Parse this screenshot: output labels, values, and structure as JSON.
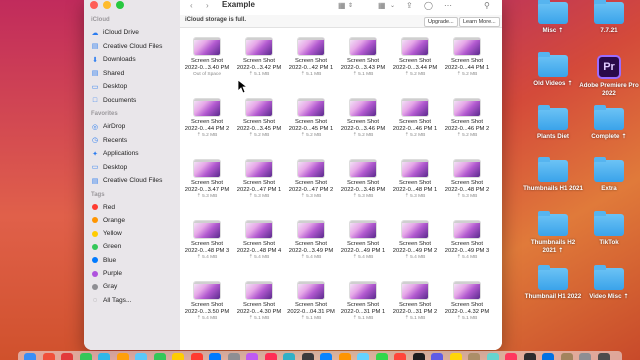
{
  "window": {
    "title": "Example"
  },
  "sidebar": {
    "icloud_header": "iCloud",
    "icloud_items": [
      {
        "label": "iCloud Drive",
        "icon": "cloud-icon"
      },
      {
        "label": "Creative Cloud Files",
        "icon": "folder-icon"
      },
      {
        "label": "Downloads",
        "icon": "download-icon"
      },
      {
        "label": "Shared",
        "icon": "shared-folder-icon"
      },
      {
        "label": "Desktop",
        "icon": "desktop-icon"
      },
      {
        "label": "Documents",
        "icon": "document-icon"
      }
    ],
    "favorites_header": "Favorites",
    "favorite_items": [
      {
        "label": "AirDrop",
        "icon": "airdrop-icon"
      },
      {
        "label": "Recents",
        "icon": "clock-icon"
      },
      {
        "label": "Applications",
        "icon": "applications-icon"
      },
      {
        "label": "Desktop",
        "icon": "desktop-icon"
      },
      {
        "label": "Creative Cloud Files",
        "icon": "folder-icon"
      }
    ],
    "tags_header": "Tags",
    "tags": [
      {
        "label": "Red",
        "color": "#ff3b30"
      },
      {
        "label": "Orange",
        "color": "#ff9500"
      },
      {
        "label": "Yellow",
        "color": "#ffcc00"
      },
      {
        "label": "Green",
        "color": "#34c759"
      },
      {
        "label": "Blue",
        "color": "#007aff"
      },
      {
        "label": "Purple",
        "color": "#af52de"
      },
      {
        "label": "Gray",
        "color": "#8e8e93"
      },
      {
        "label": "All Tags...",
        "color": ""
      }
    ]
  },
  "notice": {
    "text": "iCloud storage is full.",
    "upgrade": "Upgrade...",
    "learn_more": "Learn More..."
  },
  "files": [
    [
      {
        "name": "Screen Shot",
        "date": "2022-0...3.40 PM",
        "meta": "Out of Space"
      },
      {
        "name": "Screen Shot",
        "date": "2022-0...3.42 PM",
        "meta": "⇡ 5.1 MB"
      },
      {
        "name": "Screen Shot",
        "date": "2022-0...42 PM 1",
        "meta": "⇡ 5.1 MB"
      },
      {
        "name": "Screen Shot",
        "date": "2022-0...3.43 PM",
        "meta": "⇡ 5.1 MB"
      },
      {
        "name": "Screen Shot",
        "date": "2022-0...3.44 PM",
        "meta": "⇡ 5.2 MB"
      },
      {
        "name": "Screen Shot",
        "date": "2022-0...44 PM 1",
        "meta": "⇡ 5.2 MB"
      }
    ],
    [
      {
        "name": "Screen Shot",
        "date": "2022-0...44 PM 2",
        "meta": "⇡ 5.2 MB"
      },
      {
        "name": "Screen Shot",
        "date": "2022-0...3.45 PM",
        "meta": "⇡ 5.2 MB"
      },
      {
        "name": "Screen Shot",
        "date": "2022-0...45 PM 1",
        "meta": "⇡ 5.2 MB"
      },
      {
        "name": "Screen Shot",
        "date": "2022-0...3.46 PM",
        "meta": "⇡ 5.2 MB"
      },
      {
        "name": "Screen Shot",
        "date": "2022-0...46 PM 1",
        "meta": "⇡ 5.2 MB"
      },
      {
        "name": "Screen Shot",
        "date": "2022-0...46 PM 2",
        "meta": "⇡ 5.2 MB"
      }
    ],
    [
      {
        "name": "Screen Shot",
        "date": "2022-0...3.47 PM",
        "meta": "⇡ 5.3 MB"
      },
      {
        "name": "Screen Shot",
        "date": "2022-0...47 PM 1",
        "meta": "⇡ 5.3 MB"
      },
      {
        "name": "Screen Shot",
        "date": "2022-0...47 PM 2",
        "meta": "⇡ 5.3 MB"
      },
      {
        "name": "Screen Shot",
        "date": "2022-0...3.48 PM",
        "meta": "⇡ 5.3 MB"
      },
      {
        "name": "Screen Shot",
        "date": "2022-0...48 PM 1",
        "meta": "⇡ 5.3 MB"
      },
      {
        "name": "Screen Shot",
        "date": "2022-0...48 PM 2",
        "meta": "⇡ 5.3 MB"
      }
    ],
    [
      {
        "name": "Screen Shot",
        "date": "2022-0...48 PM 3",
        "meta": "⇡ 5.4 MB"
      },
      {
        "name": "Screen Shot",
        "date": "2022-0...48 PM 4",
        "meta": "⇡ 5.4 MB"
      },
      {
        "name": "Screen Shot",
        "date": "2022-0...3.49 PM",
        "meta": "⇡ 5.4 MB"
      },
      {
        "name": "Screen Shot",
        "date": "2022-0...49 PM 1",
        "meta": "⇡ 5.4 MB"
      },
      {
        "name": "Screen Shot",
        "date": "2022-0...49 PM 2",
        "meta": "⇡ 5.4 MB"
      },
      {
        "name": "Screen Shot",
        "date": "2022-0...49 PM 3",
        "meta": "⇡ 5.4 MB"
      }
    ],
    [
      {
        "name": "Screen Shot",
        "date": "2022-0...3.50 PM",
        "meta": "⇡ 5.4 MB"
      },
      {
        "name": "Screen Shot",
        "date": "2022-0...4.30 PM",
        "meta": "⇡ 5.1 MB"
      },
      {
        "name": "Screen Shot",
        "date": "2022-0...04.31 PM",
        "meta": "⇡ 5.1 MB"
      },
      {
        "name": "Screen Shot",
        "date": "2022-0...31 PM 1",
        "meta": "⇡ 5.1 MB"
      },
      {
        "name": "Screen Shot",
        "date": "2022-0...31 PM 2",
        "meta": "⇡ 5.1 MB"
      },
      {
        "name": "Screen Shot",
        "date": "2022-0...4.32 PM",
        "meta": "⇡ 5.1 MB"
      }
    ]
  ],
  "desktop": [
    {
      "label": "Misc",
      "status": "⇡",
      "type": "folder"
    },
    {
      "label": "7.7.21",
      "status": "",
      "type": "folder"
    },
    {
      "label": "Old Videos",
      "status": "⇡",
      "type": "folder"
    },
    {
      "label": "Adobe Premiere Pro 2022",
      "status": "",
      "type": "app",
      "app_letters": "Pr"
    },
    {
      "label": "Plants Diet",
      "status": "",
      "type": "folder"
    },
    {
      "label": "Complete",
      "status": "⇡",
      "type": "folder"
    },
    {
      "label": "Thumbnails H1 2021",
      "status": "",
      "type": "folder"
    },
    {
      "label": "Extra",
      "status": "",
      "type": "folder"
    },
    {
      "label": "Thumbnails H2 2021",
      "status": "⇡",
      "type": "folder"
    },
    {
      "label": "TikTok",
      "status": "",
      "type": "folder"
    },
    {
      "label": "Thumbnail H1 2022",
      "status": "",
      "type": "folder"
    },
    {
      "label": "Video Misc",
      "status": "⇡",
      "type": "folder"
    }
  ],
  "dock_colors": [
    "#3a8ef6",
    "#f0503a",
    "#e23b3b",
    "#35c759",
    "#2fb7e8",
    "#ff9f0a",
    "#5ac8fa",
    "#34c759",
    "#ffcc00",
    "#ff3b30",
    "#007aff",
    "#8e8e93",
    "#bf5af2",
    "#ff2d55",
    "#30b0c7",
    "#3a3a3c",
    "#0a84ff",
    "#ff9500",
    "#64d2ff",
    "#32d74b",
    "#ff453a",
    "#1c1c1e",
    "#5e5ce6",
    "#ffd60a",
    "#ac8e68",
    "#66d4cf",
    "#ff375f",
    "#2c2c2e",
    "#0071e3",
    "#a2845e",
    "#8e8e93",
    "#4c4c4c"
  ]
}
